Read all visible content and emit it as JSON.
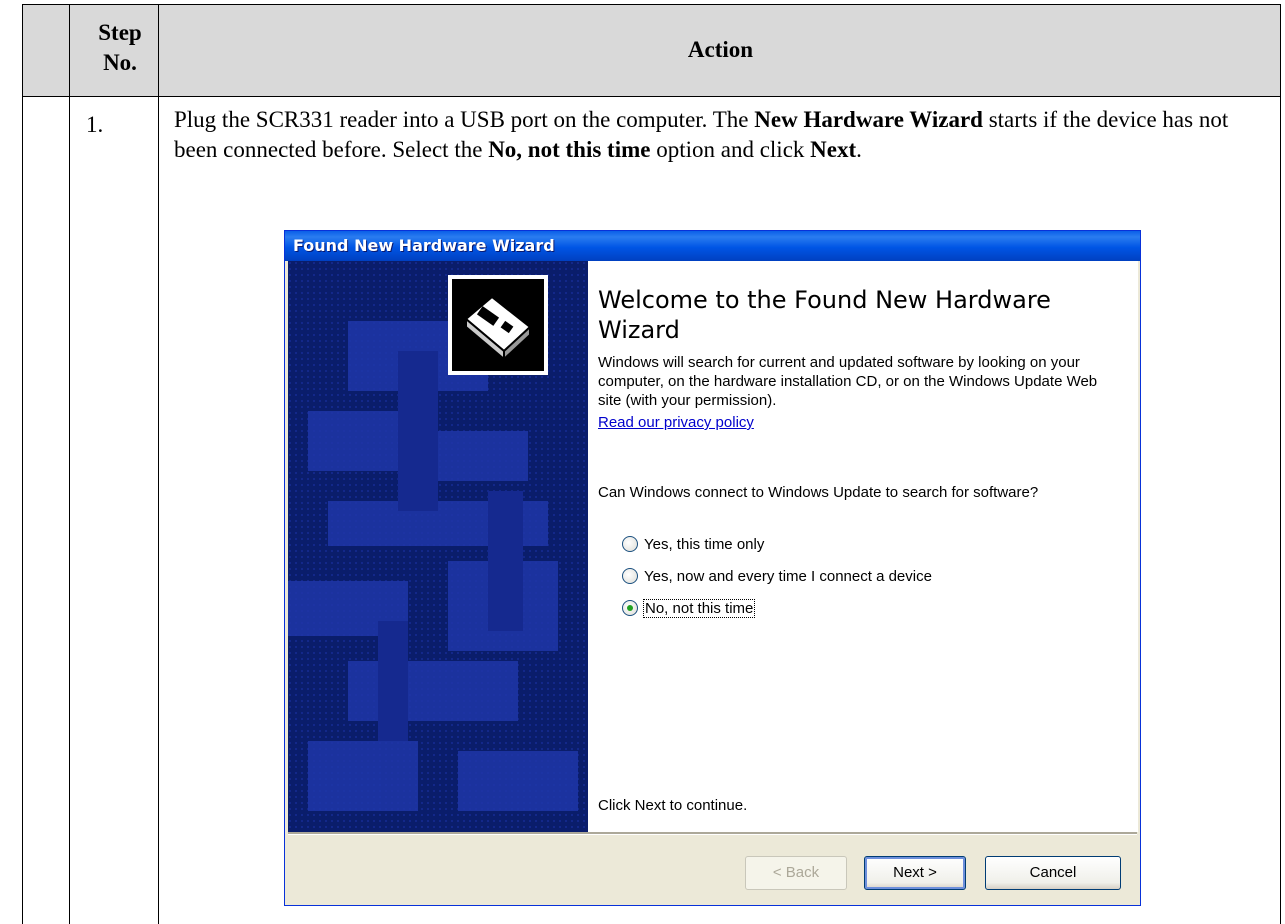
{
  "table": {
    "header": {
      "step": "Step No.",
      "action": "Action"
    },
    "rows": [
      {
        "step": "1.",
        "instruction": {
          "p1": "Plug the SCR331 reader into a USB port on the computer.  The ",
          "b1": "New Hardware Wizard",
          "p2": " starts if the device has not been connected before.  Select the ",
          "b2": "No, not this time",
          "p3": " option and click ",
          "b3": "Next",
          "p4": "."
        }
      }
    ]
  },
  "wizard": {
    "title": "Found New Hardware Wizard",
    "heading": "Welcome to the Found New Hardware Wizard",
    "intro": "Windows will search for current and updated software by looking on your computer, on the hardware installation CD, or on the Windows Update Web site (with your permission).",
    "privacy_link": "Read our privacy policy",
    "question": "Can Windows connect to Windows Update to search for software?",
    "options": [
      {
        "label": "Yes, this time only",
        "selected": false
      },
      {
        "label": "Yes, now and every time I connect a device",
        "selected": false
      },
      {
        "label": "No, not this time",
        "selected": true
      }
    ],
    "continue_text": "Click Next to continue.",
    "buttons": {
      "back": "< Back",
      "next": "Next >",
      "cancel": "Cancel"
    },
    "icon": "hardware-card-icon",
    "colors": {
      "titlebar": "#0055e5",
      "side_panel": "#0a1d6b",
      "selected_radio": "#21a121"
    }
  }
}
